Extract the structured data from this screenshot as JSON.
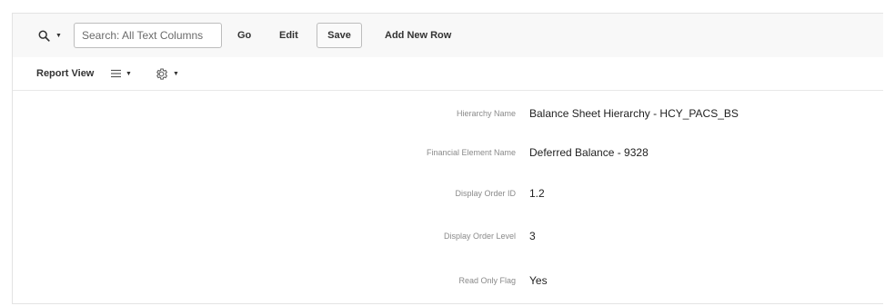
{
  "toolbar": {
    "search_icon": "magnifier-icon",
    "search_placeholder": "Search: All Text Columns",
    "go_label": "Go",
    "edit_label": "Edit",
    "save_label": "Save",
    "add_row_label": "Add New Row"
  },
  "subbar": {
    "report_view_label": "Report View",
    "view_menu_icon": "hamburger-icon",
    "actions_menu_icon": "gear-icon"
  },
  "record": {
    "fields": [
      {
        "label": "Hierarchy Name",
        "value": "Balance Sheet Hierarchy - HCY_PACS_BS"
      },
      {
        "label": "Financial Element Name",
        "value": "Deferred Balance - 9328"
      },
      {
        "label": "Display Order ID",
        "value": "1.2"
      },
      {
        "label": "Display Order Level",
        "value": "3"
      },
      {
        "label": "Read Only Flag",
        "value": "Yes"
      }
    ]
  },
  "colors": {
    "toolbar_bg": "#f8f8f8",
    "border": "#bdbdbd",
    "label_text": "#8a8a8a",
    "value_text": "#222222"
  }
}
